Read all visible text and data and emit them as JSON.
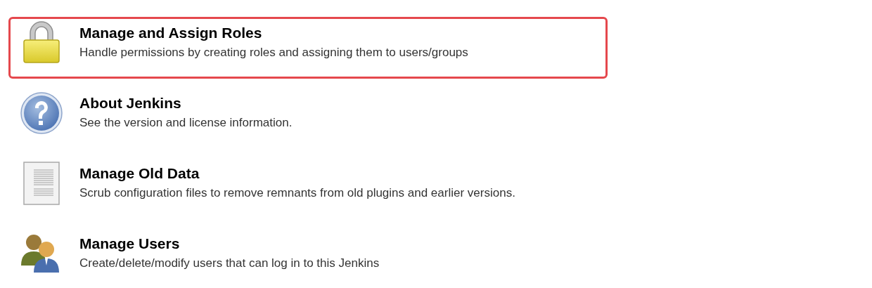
{
  "items": [
    {
      "kind": "lock",
      "title": "Manage and Assign Roles",
      "description": "Handle permissions by creating roles and assigning them to users/groups",
      "highlighted": true
    },
    {
      "kind": "help",
      "title": "About Jenkins",
      "description": "See the version and license information.",
      "highlighted": false
    },
    {
      "kind": "document",
      "title": "Manage Old Data",
      "description": "Scrub configuration files to remove remnants from old plugins and earlier versions.",
      "highlighted": false
    },
    {
      "kind": "users",
      "title": "Manage Users",
      "description": "Create/delete/modify users that can log in to this Jenkins",
      "highlighted": false
    }
  ]
}
